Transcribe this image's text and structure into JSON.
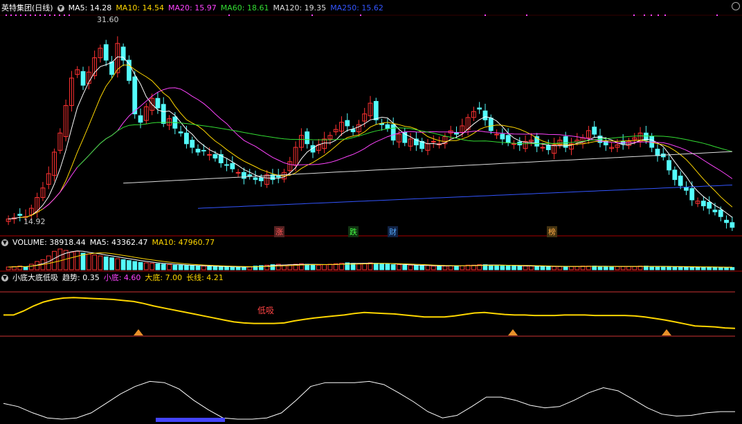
{
  "header": {
    "name": "英特集团(日线)",
    "ma": [
      {
        "label": "MA5: 14.28",
        "color": "#ffffff"
      },
      {
        "label": "MA10: 14.54",
        "color": "#ffd700"
      },
      {
        "label": "MA20: 15.97",
        "color": "#ff44ff"
      },
      {
        "label": "MA60: 18.61",
        "color": "#33dd33"
      },
      {
        "label": "MA120: 19.35",
        "color": "#dddddd"
      },
      {
        "label": "MA250: 15.62",
        "color": "#3355ff"
      }
    ]
  },
  "volume_header": {
    "items": [
      {
        "label": "VOLUME: 38918.44",
        "color": "#ffffff"
      },
      {
        "label": "MA5: 43362.47",
        "color": "#ffffff"
      },
      {
        "label": "MA10: 47960.77",
        "color": "#ffd700"
      }
    ]
  },
  "indicator_header": {
    "title": "小底大底低吸",
    "items": [
      {
        "label": "趋势: 0.35",
        "color": "#ffffff"
      },
      {
        "label": "小底: 4.60",
        "color": "#ff44ff"
      },
      {
        "label": "大底: 7.00",
        "color": "#ffd700"
      },
      {
        "label": "长线: 4.21",
        "color": "#ffd700"
      }
    ]
  },
  "annotations": {
    "high": "31.60",
    "low": "14.92",
    "markers": [
      {
        "text": "涨",
        "color": "#ff5555",
        "bg": "#552222"
      },
      {
        "text": "跌",
        "color": "#44ff44",
        "bg": "#113311"
      },
      {
        "text": "财",
        "color": "#55aaff",
        "bg": "#112244"
      },
      {
        "text": "榜",
        "color": "#ffaa44",
        "bg": "#443311"
      }
    ],
    "dixi": "低吸"
  },
  "chart_data": {
    "type": "candlestick",
    "title": "英特集团(日线)",
    "price_range": [
      14.92,
      31.6
    ],
    "up_color": "#ff3232",
    "down_color": "#54fcfc",
    "series": [
      {
        "name": "MA5",
        "last": 14.28
      },
      {
        "name": "MA10",
        "last": 14.54
      },
      {
        "name": "MA20",
        "last": 15.97
      },
      {
        "name": "MA60",
        "last": 18.61
      },
      {
        "name": "MA120",
        "last": 19.35
      },
      {
        "name": "MA250",
        "last": 15.62
      }
    ],
    "close": [
      15.0,
      15.1,
      15.3,
      15.2,
      15.9,
      16.8,
      17.6,
      18.8,
      20.6,
      22.2,
      24.5,
      26.8,
      27.5,
      26.2,
      27.3,
      28.5,
      29.3,
      28.3,
      27.1,
      29.7,
      28.3,
      26.6,
      23.8,
      23.1,
      24.4,
      25.1,
      24.3,
      23.0,
      23.4,
      22.6,
      22.2,
      21.3,
      21.0,
      20.6,
      20.7,
      20.4,
      20.1,
      19.7,
      19.5,
      19.2,
      18.9,
      18.4,
      18.6,
      18.3,
      18.2,
      18.7,
      18.3,
      18.5,
      18.9,
      19.8,
      21.0,
      22.0,
      21.3,
      20.6,
      21.2,
      21.7,
      22.0,
      22.5,
      23.1,
      22.8,
      22.3,
      22.9,
      23.8,
      24.7,
      23.3,
      22.9,
      22.6,
      21.6,
      22.1,
      21.4,
      21.7,
      21.2,
      20.9,
      21.3,
      21.5,
      21.3,
      21.9,
      22.4,
      22.1,
      22.8,
      23.5,
      24.0,
      24.2,
      23.3,
      22.4,
      22.1,
      21.7,
      21.4,
      21.3,
      21.2,
      21.5,
      21.6,
      21.1,
      21.0,
      20.8,
      21.2,
      21.6,
      21.0,
      21.3,
      21.6,
      21.8,
      22.4,
      22.1,
      21.4,
      21.2,
      21.0,
      21.2,
      21.3,
      21.5,
      21.8,
      22.2,
      21.6,
      21.0,
      20.3,
      20.2,
      19.1,
      18.3,
      17.8,
      17.4,
      16.6,
      16.5,
      16.1,
      15.9,
      15.6,
      15.2,
      14.7,
      14.3
    ],
    "volume": [
      6,
      7,
      8,
      6,
      12,
      18,
      22,
      30,
      40,
      45,
      42,
      38,
      40,
      36,
      34,
      32,
      30,
      28,
      26,
      24,
      22,
      20,
      18,
      16,
      15,
      14,
      13,
      12,
      11,
      10,
      10,
      9,
      9,
      8,
      8,
      7,
      7,
      7,
      6,
      6,
      6,
      6,
      7,
      8,
      9,
      10,
      11,
      12,
      10,
      11,
      12,
      13,
      12,
      11,
      10,
      11,
      12,
      13,
      14,
      15,
      14,
      13,
      14,
      15,
      14,
      13,
      12,
      11,
      11,
      10,
      10,
      9,
      9,
      9,
      8,
      8,
      8,
      9,
      9,
      9,
      10,
      10,
      11,
      11,
      10,
      10,
      9,
      9,
      8,
      8,
      8,
      8,
      8,
      7,
      7,
      7,
      7,
      7,
      7,
      7,
      8,
      8,
      8,
      7,
      7,
      7,
      7,
      7,
      7,
      7,
      8,
      8,
      7,
      7,
      7,
      7,
      6,
      6,
      6,
      6,
      6,
      6,
      6,
      5,
      5,
      5,
      5
    ],
    "trend_line": [
      0.62,
      0.62,
      0.7,
      0.8,
      0.88,
      0.93,
      0.96,
      0.97,
      0.96,
      0.95,
      0.94,
      0.93,
      0.91,
      0.89,
      0.85,
      0.8,
      0.76,
      0.72,
      0.68,
      0.64,
      0.6,
      0.56,
      0.52,
      0.48,
      0.46,
      0.45,
      0.45,
      0.45,
      0.46,
      0.5,
      0.53,
      0.56,
      0.58,
      0.6,
      0.62,
      0.65,
      0.67,
      0.66,
      0.65,
      0.64,
      0.62,
      0.6,
      0.58,
      0.58,
      0.58,
      0.6,
      0.63,
      0.66,
      0.67,
      0.65,
      0.63,
      0.62,
      0.62,
      0.61,
      0.61,
      0.61,
      0.62,
      0.62,
      0.62,
      0.61,
      0.61,
      0.61,
      0.61,
      0.6,
      0.58,
      0.55,
      0.52,
      0.48,
      0.44,
      0.4,
      0.39,
      0.38,
      0.36,
      0.35
    ],
    "long_line": [
      0.25,
      0.2,
      0.1,
      0.02,
      0.0,
      0.02,
      0.1,
      0.25,
      0.4,
      0.52,
      0.6,
      0.58,
      0.48,
      0.3,
      0.15,
      0.02,
      0.0,
      0.0,
      0.02,
      0.1,
      0.3,
      0.52,
      0.58,
      0.58,
      0.58,
      0.6,
      0.55,
      0.42,
      0.28,
      0.12,
      0.02,
      0.06,
      0.2,
      0.35,
      0.35,
      0.3,
      0.22,
      0.18,
      0.2,
      0.3,
      0.42,
      0.5,
      0.45,
      0.32,
      0.18,
      0.08,
      0.05,
      0.06,
      0.1,
      0.12,
      0.12
    ]
  }
}
